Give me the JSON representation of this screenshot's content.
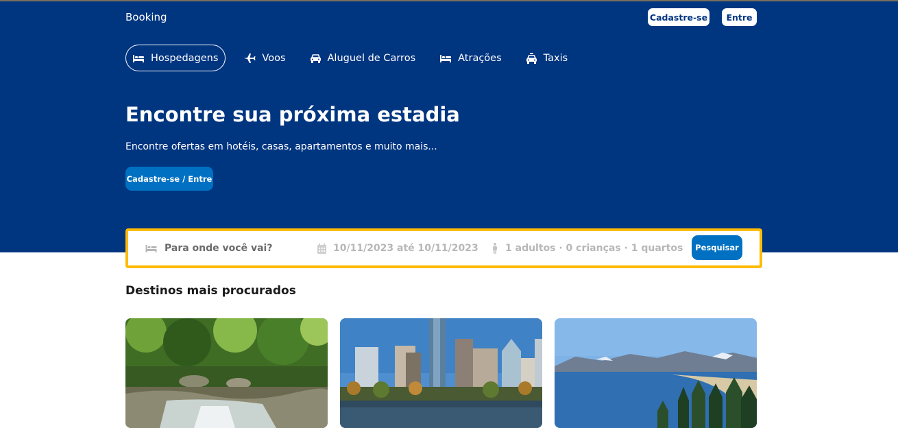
{
  "header": {
    "brand": "Booking",
    "register_label": "Cadastre-se",
    "login_label": "Entre"
  },
  "nav": {
    "items": [
      {
        "label": "Hospedagens",
        "icon": "bed-icon",
        "active": true
      },
      {
        "label": "Voos",
        "icon": "plane-icon",
        "active": false
      },
      {
        "label": "Aluguel de Carros",
        "icon": "car-icon",
        "active": false
      },
      {
        "label": "Atrações",
        "icon": "bed-icon",
        "active": false
      },
      {
        "label": "Taxis",
        "icon": "taxi-icon",
        "active": false
      }
    ]
  },
  "hero": {
    "title": "Encontre sua próxima estadia",
    "subtitle": "Encontre ofertas em hotéis, casas, apartamentos e muito mais...",
    "cta_label": "Cadastre-se / Entre"
  },
  "search": {
    "destination_placeholder": "Para onde você vai?",
    "dates": "10/11/2023 até 10/11/2023",
    "guests": "1 adultos · 0 crianças · 1 quartos",
    "submit_label": "Pesquisar"
  },
  "destinations": {
    "title": "Destinos mais procurados",
    "items": [
      {
        "image": "forest-waterfall"
      },
      {
        "image": "city-skyline"
      },
      {
        "image": "mountain-lake"
      }
    ]
  },
  "colors": {
    "hero_bg": "#003580",
    "accent": "#0071c2",
    "search_border": "#febb02"
  }
}
